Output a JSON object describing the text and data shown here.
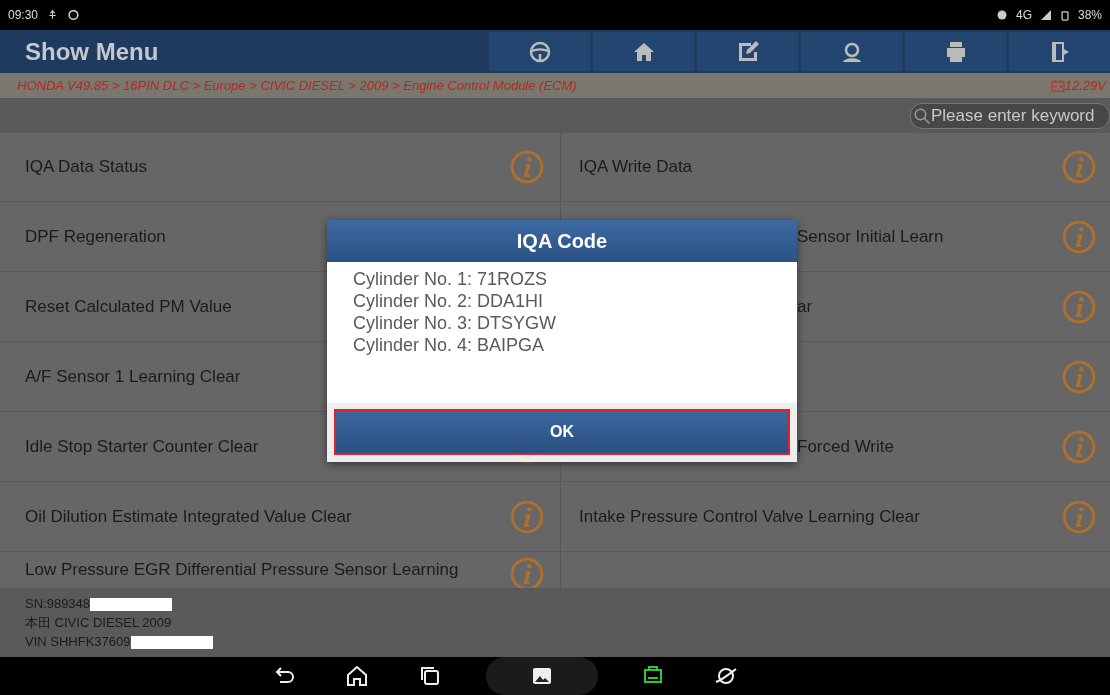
{
  "status_bar": {
    "time": "09:30",
    "network": "4G",
    "battery": "38%"
  },
  "header": {
    "title": "Show Menu",
    "buttons": [
      {
        "kind": "steering-wheel"
      },
      {
        "kind": "home"
      },
      {
        "kind": "edit"
      },
      {
        "kind": "support"
      },
      {
        "kind": "print"
      },
      {
        "kind": "exit"
      }
    ]
  },
  "breadcrumb": {
    "path": "HONDA V49.85 > 16PIN DLC > Europe > CIVIC DIESEL > 2009 > Engine Control Module (ECM)",
    "voltage": "12.29V"
  },
  "search": {
    "placeholder": "Please enter keyword"
  },
  "menu_rows": [
    {
      "left": {
        "label": "IQA Data Status",
        "info": true
      },
      "right": {
        "label": "IQA Write Data",
        "info": true,
        "clipped": false
      }
    },
    {
      "left": {
        "label": "DPF Regeneration",
        "info": false
      },
      "right": {
        "label": "Sensor Initial Learn",
        "info": true,
        "clipped": true
      }
    },
    {
      "left": {
        "label": "Reset Calculated PM Value",
        "info": false
      },
      "right": {
        "label": "ar",
        "info": true,
        "clipped": true
      }
    },
    {
      "left": {
        "label": "A/F Sensor 1 Learning Clear",
        "info": false
      },
      "right": {
        "info": true,
        "clipped": true
      }
    },
    {
      "left": {
        "label": "Idle Stop Starter Counter Clear",
        "info": true
      },
      "right": {
        "label": "Forced Write",
        "info": true,
        "clipped": true
      }
    },
    {
      "left": {
        "label": "Oil Dilution Estimate Integrated Value Clear",
        "info": true
      },
      "right": {
        "label": "Intake Pressure Control Valve Learning Clear",
        "info": true,
        "clipped": false
      }
    },
    {
      "left": {
        "label": "Low Pressure EGR Differential Pressure Sensor Learning",
        "info": true
      }
    }
  ],
  "footer": {
    "lines": [
      {
        "text": "SN:989348",
        "redacted": true
      },
      {
        "text": "本田 CIVIC DIESEL 2009",
        "redacted": false
      },
      {
        "text": "VIN SHHFK37609",
        "redacted": true
      }
    ]
  },
  "dialog": {
    "title": "IQA Code",
    "lines": [
      "Cylinder No. 1: 71ROZS",
      "Cylinder No. 2: DDA1HI",
      "Cylinder No. 3: DTSYGW",
      "Cylinder No. 4: BAIPGA"
    ],
    "button": "OK"
  },
  "nav_bar": [
    {
      "kind": "back"
    },
    {
      "kind": "home"
    },
    {
      "kind": "recents"
    },
    {
      "kind": "gallery"
    },
    {
      "kind": "vci"
    },
    {
      "kind": "browser"
    }
  ]
}
